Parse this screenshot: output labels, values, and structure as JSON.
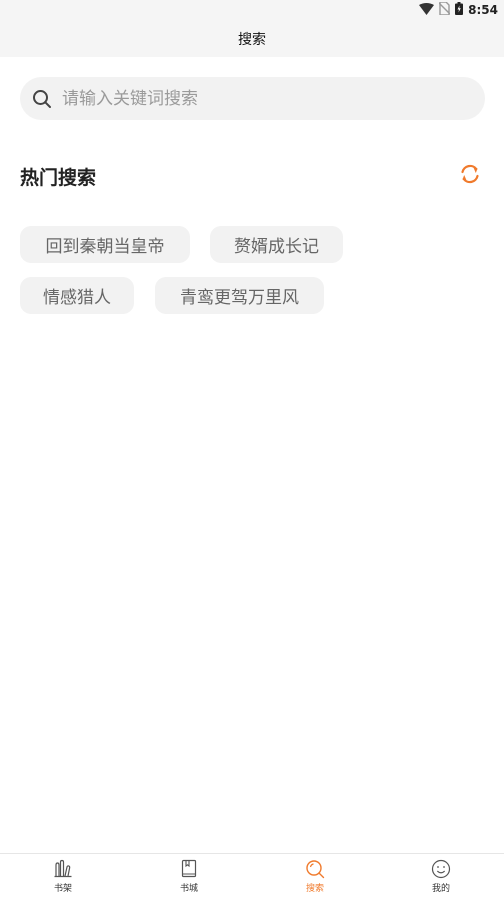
{
  "status": {
    "time": "8:54"
  },
  "header": {
    "title": "搜索"
  },
  "search": {
    "placeholder": "请输入关键词搜索",
    "value": ""
  },
  "hot": {
    "title": "热门搜索",
    "tags": [
      "回到秦朝当皇帝",
      "赘婿成长记",
      "情感猎人",
      "青鸾更驾万里风"
    ]
  },
  "tabs": [
    {
      "label": "书架",
      "icon": "bookshelf-icon"
    },
    {
      "label": "书城",
      "icon": "book-icon"
    },
    {
      "label": "搜索",
      "icon": "search-icon",
      "active": true
    },
    {
      "label": "我的",
      "icon": "smiley-icon"
    }
  ],
  "colors": {
    "accent": "#f07a2c",
    "tag_bg": "#f2f2f2"
  }
}
